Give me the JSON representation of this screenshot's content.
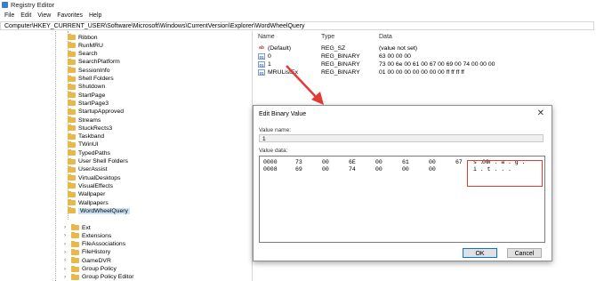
{
  "window": {
    "title": "Registry Editor"
  },
  "menu": [
    "File",
    "Edit",
    "View",
    "Favorites",
    "Help"
  ],
  "address": "Computer\\HKEY_CURRENT_USER\\Software\\Microsoft\\Windows\\CurrentVersion\\Explorer\\WordWheelQuery",
  "tree": {
    "items": [
      "Ribbon",
      "RunMRU",
      "Search",
      "SearchPlatform",
      "SessionInfo",
      "Shell Folders",
      "Shutdown",
      "StartPage",
      "StartPage3",
      "StartupApproved",
      "Streams",
      "StuckRects3",
      "Taskband",
      "TWinUI",
      "TypedPaths",
      "User Shell Folders",
      "UserAssist",
      "VirtualDesktops",
      "VisualEffects",
      "Wallpaper",
      "Wallpapers",
      "WordWheelQuery"
    ],
    "lower_items": [
      "Ext",
      "Extensions",
      "FileAssociations",
      "FileHistory",
      "GameDVR",
      "Group Policy",
      "Group Policy Editor"
    ]
  },
  "list": {
    "headers": {
      "name": "Name",
      "type": "Type",
      "data": "Data"
    },
    "rows": [
      {
        "icon": "ab",
        "name": "(Default)",
        "type": "REG_SZ",
        "data": "(value not set)"
      },
      {
        "icon": "bin",
        "name": "0",
        "type": "REG_BINARY",
        "data": "63 00 00 00"
      },
      {
        "icon": "bin",
        "name": "1",
        "type": "REG_BINARY",
        "data": "73 00 6e 00 61 00 67 00 69 00 74 00 00 00"
      },
      {
        "icon": "bin",
        "name": "MRUListEx",
        "type": "REG_BINARY",
        "data": "01 00 00 00 00 00 00 00 ff ff ff ff"
      }
    ]
  },
  "dialog": {
    "title": "Edit Binary Value",
    "value_name_label": "Value name:",
    "value_name": "1",
    "value_data_label": "Value data:",
    "hex_rows": [
      {
        "offset": "0000",
        "bytes": [
          "73",
          "00",
          "6E",
          "00",
          "61",
          "00",
          "67",
          "00"
        ],
        "ascii": "s . n . a . g ."
      },
      {
        "offset": "0008",
        "bytes": [
          "69",
          "00",
          "74",
          "00",
          "00",
          "00"
        ],
        "ascii": "i . t . . ."
      }
    ],
    "ok_label": "OK",
    "cancel_label": "Cancel"
  },
  "colors": {
    "highlight": "#e53935",
    "arrow": "#e53935",
    "folder": "#e8b84a",
    "selection": "#cce4f7"
  }
}
